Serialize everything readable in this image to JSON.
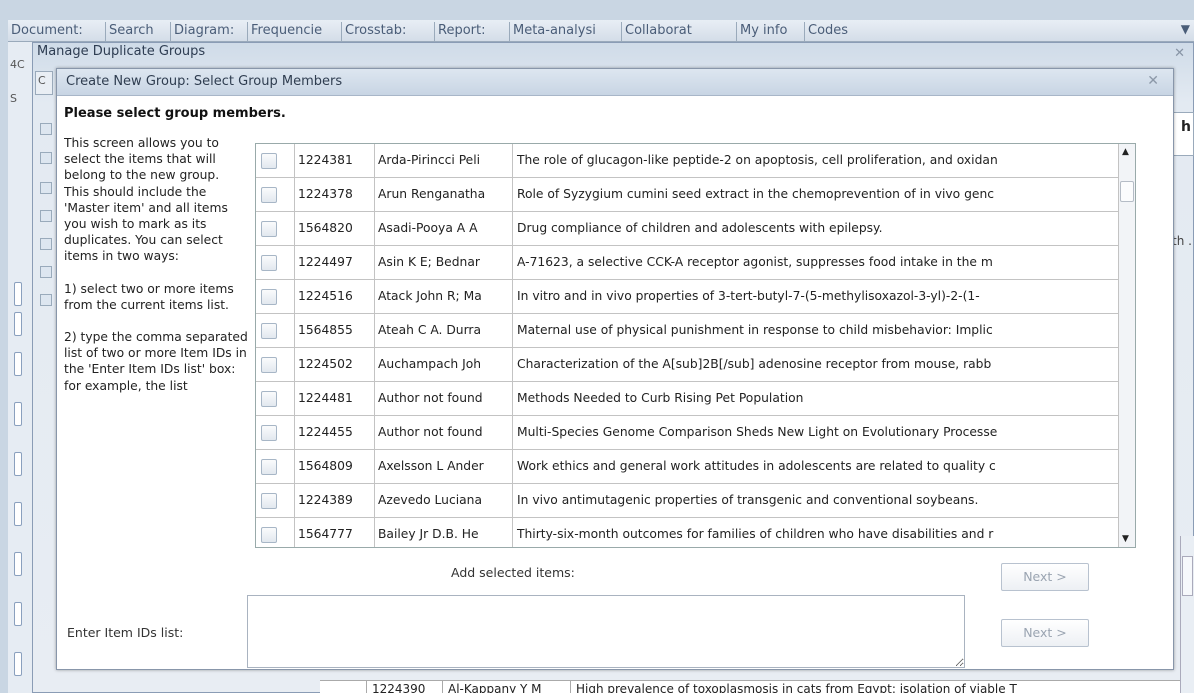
{
  "tabs": [
    "Document:",
    "Search",
    "Diagram:",
    "Frequencie",
    "Crosstab:",
    "Report:",
    "Meta-analysi",
    "Collaborat",
    "My info",
    "Codes"
  ],
  "background": {
    "side_label_1": "4C",
    "side_label_2": "S",
    "side_label_3": "C",
    "right_label_1": "h",
    "right_label_2": "th .",
    "bottom_row": {
      "id": "1224390",
      "author": "Al-Kappany Y M",
      "title": "High prevalence of toxoplasmosis in cats from Egypt: isolation of viable T"
    }
  },
  "manage_dialog": {
    "title": "Manage Duplicate Groups"
  },
  "dialog": {
    "title": "Create New Group: Select Group Members",
    "heading": "Please select group members.",
    "instructions": [
      "This screen allows you to select the items that will belong to the new group.\n This should include the 'Master item' and all items you wish to mark as its duplicates. You can select items in two ways:",
      " 1) select two or more items from the current items list.",
      " 2) type the comma separated list of two or more Item IDs in the 'Enter Item IDs list' box:\n for example, the list"
    ],
    "add_label": "Add selected items:",
    "next_label": "Next >",
    "ids_label": "Enter Item IDs list:",
    "ids_value": ""
  },
  "items": [
    {
      "id": "1224381",
      "author": "Arda-Pirincci Peli",
      "title": "The role of glucagon-like peptide-2 on apoptosis, cell proliferation, and oxidan"
    },
    {
      "id": "1224378",
      "author": "Arun Renganatha",
      "title": "Role of Syzygium cumini seed extract in the chemoprevention of in vivo genc"
    },
    {
      "id": "1564820",
      "author": "Asadi-Pooya A A",
      "title": "Drug compliance of children and adolescents with epilepsy."
    },
    {
      "id": "1224497",
      "author": "Asin K E; Bednar",
      "title": "A-71623, a selective CCK-A receptor agonist, suppresses food intake in the m"
    },
    {
      "id": "1224516",
      "author": "Atack John R; Ma",
      "title": "In vitro and in vivo properties of 3-tert-butyl-7-(5-methylisoxazol-3-yl)-2-(1-"
    },
    {
      "id": "1564855",
      "author": "Ateah C A. Durra",
      "title": "Maternal use of physical punishment in response to child misbehavior: Implic"
    },
    {
      "id": "1224502",
      "author": "Auchampach Joh",
      "title": "Characterization of the A[sub]2B[/sub] adenosine receptor from mouse, rabb"
    },
    {
      "id": "1224481",
      "author": "Author not found",
      "title": "Methods Needed to Curb Rising Pet Population"
    },
    {
      "id": "1224455",
      "author": "Author not found",
      "title": "Multi-Species Genome Comparison Sheds New Light on Evolutionary Processe"
    },
    {
      "id": "1564809",
      "author": "Axelsson L Ander",
      "title": "Work ethics and general work attitudes in adolescents are related to quality c"
    },
    {
      "id": "1224389",
      "author": "Azevedo Luciana",
      "title": "In vivo antimutagenic properties of transgenic and conventional soybeans."
    },
    {
      "id": "1564777",
      "author": "Bailey Jr D.B. He",
      "title": "Thirty-six-month outcomes for families of children who have disabilities and r"
    }
  ]
}
